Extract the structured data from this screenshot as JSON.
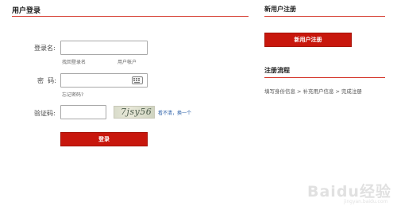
{
  "login": {
    "title": "用户登录",
    "username_label": "登录名:",
    "username_value": "",
    "forgot_username": "找回登录名",
    "username_hint": "用户帐户",
    "password_label": "密  码:",
    "password_value": "",
    "forgot_password": "忘记密码?",
    "captcha_label": "验证码:",
    "captcha_value": "",
    "captcha_image_text": "7jsy56",
    "captcha_refresh": "看不清，换一个",
    "submit_label": "登录"
  },
  "register": {
    "title": "新用户注册",
    "button_label": "新用户注册"
  },
  "process": {
    "title": "注册流程",
    "steps": [
      "填写身份信息",
      "补充用户信息",
      "完成注册"
    ],
    "separator": ">"
  },
  "watermark": {
    "text": "Baidu经验",
    "sub": "jingyan.baidu.com"
  },
  "colors": {
    "accent": "#c8170d",
    "divider": "#d53a2f",
    "link": "#2a5fa8"
  },
  "icons": {
    "keyboard": "keyboard-icon"
  }
}
